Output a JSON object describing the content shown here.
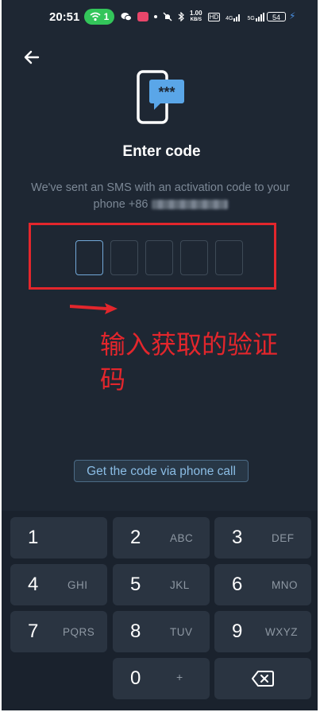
{
  "status_bar": {
    "time": "20:51",
    "hotspot_count": "1",
    "speed_value": "1.00",
    "speed_unit": "KB/S",
    "hd_label": "HD",
    "network_4g": "4G",
    "network_5g": "5G",
    "battery": "54"
  },
  "screen": {
    "title": "Enter code",
    "description": "We've sent an SMS with an activation code to your phone",
    "phone_prefix": "+86",
    "code_boxes": 5,
    "call_button": "Get the code via phone call"
  },
  "annotation": {
    "text": "输入获取的验证码",
    "color": "#e3262c"
  },
  "keypad": {
    "keys": [
      {
        "num": "1",
        "sub": ""
      },
      {
        "num": "2",
        "sub": "ABC"
      },
      {
        "num": "3",
        "sub": "DEF"
      },
      {
        "num": "4",
        "sub": "GHI"
      },
      {
        "num": "5",
        "sub": "JKL"
      },
      {
        "num": "6",
        "sub": "MNO"
      },
      {
        "num": "7",
        "sub": "PQRS"
      },
      {
        "num": "8",
        "sub": "TUV"
      },
      {
        "num": "9",
        "sub": "WXYZ"
      },
      {
        "num": "0",
        "sub": "+"
      }
    ],
    "backspace_icon": "backspace-icon"
  },
  "colors": {
    "background": "#1e2733",
    "accent": "#5aa6e8",
    "annotation_red": "#e3262c"
  }
}
